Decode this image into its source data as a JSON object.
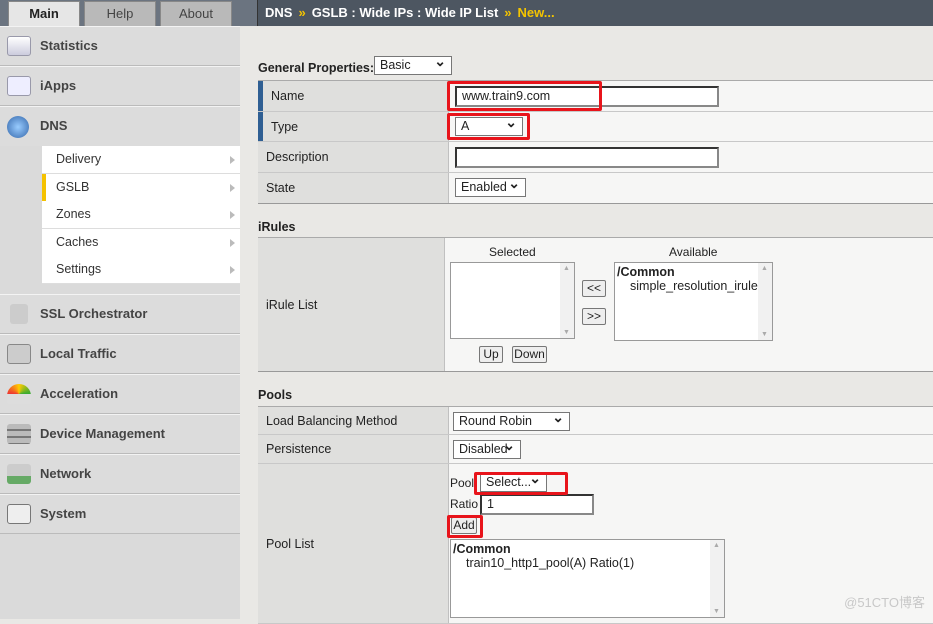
{
  "tabs": [
    {
      "label": "Main"
    },
    {
      "label": "Help"
    },
    {
      "label": "About"
    }
  ],
  "breadcrumb": {
    "parts": [
      "DNS",
      "GSLB : Wide IPs : Wide IP List"
    ],
    "current": "New...",
    "separator": "»"
  },
  "sidebar": {
    "items": [
      {
        "label": "Statistics",
        "icon": "statistics-icon"
      },
      {
        "label": "iApps",
        "icon": "iapps-icon"
      },
      {
        "label": "DNS",
        "icon": "globe-icon"
      },
      {
        "label": "SSL Orchestrator",
        "icon": "lock-icon"
      },
      {
        "label": "Local Traffic",
        "icon": "local-traffic-icon"
      },
      {
        "label": "Acceleration",
        "icon": "gauge-icon"
      },
      {
        "label": "Device Management",
        "icon": "device-icon"
      },
      {
        "label": "Network",
        "icon": "network-icon"
      },
      {
        "label": "System",
        "icon": "system-icon"
      }
    ],
    "dns_sub": [
      {
        "label": "Delivery"
      },
      {
        "label": "GSLB"
      },
      {
        "label": "Zones"
      },
      {
        "label": "Caches"
      },
      {
        "label": "Settings"
      }
    ]
  },
  "general": {
    "title": "General Properties:",
    "mode": "Basic",
    "name_label": "Name",
    "name_value": "www.train9.com",
    "type_label": "Type",
    "type_value": "A",
    "description_label": "Description",
    "description_value": "",
    "state_label": "State",
    "state_value": "Enabled"
  },
  "irules": {
    "title": "iRules",
    "row_label": "iRule List",
    "selected_header": "Selected",
    "available_header": "Available",
    "available_group": "/Common",
    "available_items": [
      "simple_resolution_irule"
    ],
    "move_left": "<<",
    "move_right": ">>",
    "up": "Up",
    "down": "Down"
  },
  "pools": {
    "title": "Pools",
    "lb_label": "Load Balancing Method",
    "lb_value": "Round Robin",
    "persistence_label": "Persistence",
    "persistence_value": "Disabled",
    "pool_list_label": "Pool List",
    "pool_label": "Pool",
    "pool_value": "Select...",
    "ratio_label": "Ratio",
    "ratio_value": "1",
    "add": "Add",
    "list_group": "/Common",
    "list_items": [
      "train10_http1_pool(A) Ratio(1)"
    ]
  },
  "watermark": "@51CTO博客",
  "colors": {
    "highlight": "#e8141b",
    "accent": "#f5c200",
    "required": "#2f5f93"
  }
}
